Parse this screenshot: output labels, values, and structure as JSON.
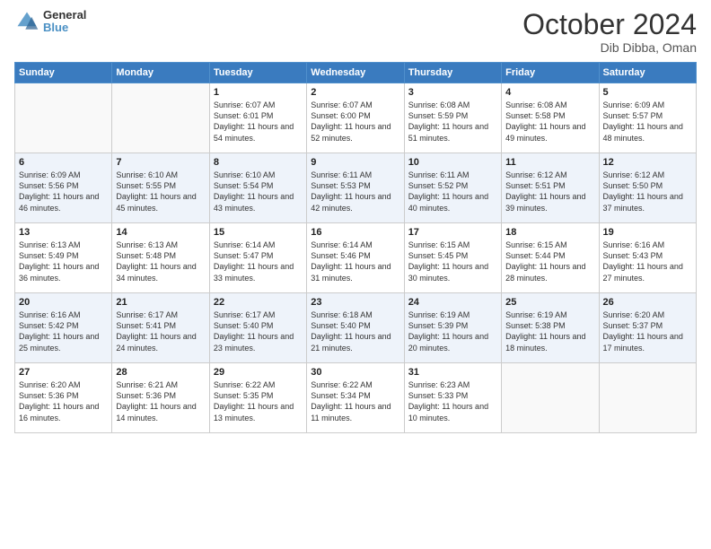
{
  "header": {
    "logo_line1": "General",
    "logo_line2": "Blue",
    "month": "October 2024",
    "location": "Dib Dibba, Oman"
  },
  "days_of_week": [
    "Sunday",
    "Monday",
    "Tuesday",
    "Wednesday",
    "Thursday",
    "Friday",
    "Saturday"
  ],
  "weeks": [
    [
      {
        "day": "",
        "empty": true
      },
      {
        "day": "",
        "empty": true
      },
      {
        "day": "1",
        "sunrise": "6:07 AM",
        "sunset": "6:01 PM",
        "daylight": "11 hours and 54 minutes."
      },
      {
        "day": "2",
        "sunrise": "6:07 AM",
        "sunset": "6:00 PM",
        "daylight": "11 hours and 52 minutes."
      },
      {
        "day": "3",
        "sunrise": "6:08 AM",
        "sunset": "5:59 PM",
        "daylight": "11 hours and 51 minutes."
      },
      {
        "day": "4",
        "sunrise": "6:08 AM",
        "sunset": "5:58 PM",
        "daylight": "11 hours and 49 minutes."
      },
      {
        "day": "5",
        "sunrise": "6:09 AM",
        "sunset": "5:57 PM",
        "daylight": "11 hours and 48 minutes."
      }
    ],
    [
      {
        "day": "6",
        "sunrise": "6:09 AM",
        "sunset": "5:56 PM",
        "daylight": "11 hours and 46 minutes."
      },
      {
        "day": "7",
        "sunrise": "6:10 AM",
        "sunset": "5:55 PM",
        "daylight": "11 hours and 45 minutes."
      },
      {
        "day": "8",
        "sunrise": "6:10 AM",
        "sunset": "5:54 PM",
        "daylight": "11 hours and 43 minutes."
      },
      {
        "day": "9",
        "sunrise": "6:11 AM",
        "sunset": "5:53 PM",
        "daylight": "11 hours and 42 minutes."
      },
      {
        "day": "10",
        "sunrise": "6:11 AM",
        "sunset": "5:52 PM",
        "daylight": "11 hours and 40 minutes."
      },
      {
        "day": "11",
        "sunrise": "6:12 AM",
        "sunset": "5:51 PM",
        "daylight": "11 hours and 39 minutes."
      },
      {
        "day": "12",
        "sunrise": "6:12 AM",
        "sunset": "5:50 PM",
        "daylight": "11 hours and 37 minutes."
      }
    ],
    [
      {
        "day": "13",
        "sunrise": "6:13 AM",
        "sunset": "5:49 PM",
        "daylight": "11 hours and 36 minutes."
      },
      {
        "day": "14",
        "sunrise": "6:13 AM",
        "sunset": "5:48 PM",
        "daylight": "11 hours and 34 minutes."
      },
      {
        "day": "15",
        "sunrise": "6:14 AM",
        "sunset": "5:47 PM",
        "daylight": "11 hours and 33 minutes."
      },
      {
        "day": "16",
        "sunrise": "6:14 AM",
        "sunset": "5:46 PM",
        "daylight": "11 hours and 31 minutes."
      },
      {
        "day": "17",
        "sunrise": "6:15 AM",
        "sunset": "5:45 PM",
        "daylight": "11 hours and 30 minutes."
      },
      {
        "day": "18",
        "sunrise": "6:15 AM",
        "sunset": "5:44 PM",
        "daylight": "11 hours and 28 minutes."
      },
      {
        "day": "19",
        "sunrise": "6:16 AM",
        "sunset": "5:43 PM",
        "daylight": "11 hours and 27 minutes."
      }
    ],
    [
      {
        "day": "20",
        "sunrise": "6:16 AM",
        "sunset": "5:42 PM",
        "daylight": "11 hours and 25 minutes."
      },
      {
        "day": "21",
        "sunrise": "6:17 AM",
        "sunset": "5:41 PM",
        "daylight": "11 hours and 24 minutes."
      },
      {
        "day": "22",
        "sunrise": "6:17 AM",
        "sunset": "5:40 PM",
        "daylight": "11 hours and 23 minutes."
      },
      {
        "day": "23",
        "sunrise": "6:18 AM",
        "sunset": "5:40 PM",
        "daylight": "11 hours and 21 minutes."
      },
      {
        "day": "24",
        "sunrise": "6:19 AM",
        "sunset": "5:39 PM",
        "daylight": "11 hours and 20 minutes."
      },
      {
        "day": "25",
        "sunrise": "6:19 AM",
        "sunset": "5:38 PM",
        "daylight": "11 hours and 18 minutes."
      },
      {
        "day": "26",
        "sunrise": "6:20 AM",
        "sunset": "5:37 PM",
        "daylight": "11 hours and 17 minutes."
      }
    ],
    [
      {
        "day": "27",
        "sunrise": "6:20 AM",
        "sunset": "5:36 PM",
        "daylight": "11 hours and 16 minutes."
      },
      {
        "day": "28",
        "sunrise": "6:21 AM",
        "sunset": "5:36 PM",
        "daylight": "11 hours and 14 minutes."
      },
      {
        "day": "29",
        "sunrise": "6:22 AM",
        "sunset": "5:35 PM",
        "daylight": "11 hours and 13 minutes."
      },
      {
        "day": "30",
        "sunrise": "6:22 AM",
        "sunset": "5:34 PM",
        "daylight": "11 hours and 11 minutes."
      },
      {
        "day": "31",
        "sunrise": "6:23 AM",
        "sunset": "5:33 PM",
        "daylight": "11 hours and 10 minutes."
      },
      {
        "day": "",
        "empty": true
      },
      {
        "day": "",
        "empty": true
      }
    ]
  ]
}
